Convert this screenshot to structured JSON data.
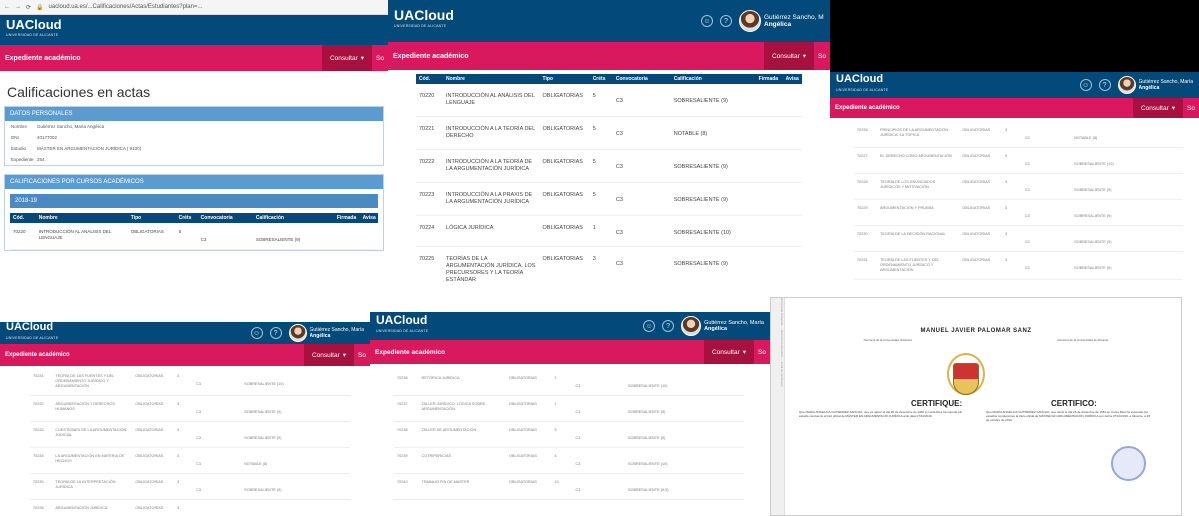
{
  "browser": {
    "url": "uacloud.ua.es/...Calificaciones/Actas/Estudiantes?plan=..."
  },
  "app": {
    "logo": "UACloud",
    "logo_sub": "UNIVERSIDAD DE ALICANTE",
    "user_line1": "Gutiérrez Sancho, María",
    "user_line2": "Angélica",
    "section": "Expediente académico",
    "consult_label": "Consultar",
    "consult_short": "So"
  },
  "page": {
    "title": "Calificaciones en actas"
  },
  "personal": {
    "header": "DATOS PERSONALES",
    "rows": [
      {
        "k": "Nombre",
        "v": "Gutiérrez Sancho, María Angélica"
      },
      {
        "k": "DNI",
        "v": "40177002"
      },
      {
        "k": "Estudio",
        "v": "MÁSTER EN ARGUMENTACIÓN JURÍDICA ( 9100)"
      },
      {
        "k": "Expediente",
        "v": "254"
      }
    ]
  },
  "grades_header": "CALIFICACIONES POR CURSOS ACADÉMICOS",
  "year": "2018-19",
  "table_headers": [
    "Cód.",
    "Nombre",
    "Tipo",
    "Créts",
    "Convocatoria",
    "Calificación",
    "Firmada",
    "Avisa"
  ],
  "rows_p1": [
    {
      "cod": "70220",
      "name": "INTRODUCCIÓN AL ANÁLISIS DEL LENGUAJE",
      "tipo": "OBLIGATORIAS",
      "creds": "5",
      "conv": "C3",
      "cal": "SOBRESALIENTE (9)"
    }
  ],
  "rows_p2": [
    {
      "cod": "70220",
      "name": "INTRODUCCIÓN AL ANÁLISIS DEL LENGUAJE",
      "tipo": "OBLIGATORIAS",
      "creds": "5",
      "conv": "C3",
      "cal": "SOBRESALIENTE (9)"
    },
    {
      "cod": "70221",
      "name": "INTRODUCCIÓN A LA TEORÍA DEL DERECHO",
      "tipo": "OBLIGATORIAS",
      "creds": "5",
      "conv": "C3",
      "cal": "NOTABLE (8)"
    },
    {
      "cod": "70222",
      "name": "INTRODUCCIÓN A LA TEORÍA DE LA ARGUMENTACIÓN JURÍDICA",
      "tipo": "OBLIGATORIAS",
      "creds": "5",
      "conv": "C3",
      "cal": "SOBRESALIENTE (9)"
    },
    {
      "cod": "70223",
      "name": "INTRODUCCIÓN A LA PRAXIS DE LA ARGUMENTACIÓN JURÍDICA",
      "tipo": "OBLIGATORIAS",
      "creds": "5",
      "conv": "C3",
      "cal": "SOBRESALIENTE (9)"
    },
    {
      "cod": "70224",
      "name": "LÓGICA JURÍDICA",
      "tipo": "OBLIGATORIAS",
      "creds": "1",
      "conv": "C3",
      "cal": "SOBRESALIENTE (10)"
    },
    {
      "cod": "70225",
      "name": "TEORÍAS DE LA ARGUMENTACIÓN JURÍDICA. LOS PRECURSORES Y LA TEORÍA ESTÁNDAR",
      "tipo": "OBLIGATORIAS",
      "creds": "3",
      "conv": "C3",
      "cal": "SOBRESALIENTE (9)"
    }
  ],
  "rows_p3": [
    {
      "cod": "70226",
      "name": "PRINCIPIOS DE LA ARGUMENTACIÓN JURÍDICA: LA TÓPICA",
      "tipo": "OBLIGATORIAS",
      "creds": "3",
      "conv": "C3",
      "cal": "NOTABLE (8)"
    },
    {
      "cod": "70227",
      "name": "EL DERECHO COMO ARGUMENTACIÓN",
      "tipo": "OBLIGATORIAS",
      "creds": "5",
      "conv": "C3",
      "cal": "SOBRESALIENTE (10)"
    },
    {
      "cod": "70228",
      "name": "TEORÍA DE LOS ENUNCIADOS JURÍDICOS Y MOTIVACIÓN",
      "tipo": "OBLIGATORIAS",
      "creds": "3",
      "conv": "C3",
      "cal": "SOBRESALIENTE (9)"
    },
    {
      "cod": "70229",
      "name": "ARGUMENTACIÓN Y PRUEBA",
      "tipo": "OBLIGATORIAS",
      "creds": "3",
      "conv": "C3",
      "cal": "SOBRESALIENTE (9)"
    },
    {
      "cod": "70230",
      "name": "TEORÍA DE LA DECISIÓN RACIONAL",
      "tipo": "OBLIGATORIAS",
      "creds": "3",
      "conv": "C3",
      "cal": "SOBRESALIENTE (9)"
    },
    {
      "cod": "70231",
      "name": "TEORÍA DE LAS FUENTES Y DEL ORDENAMIENTO JURÍDICO Y ARGUMENTACIÓN",
      "tipo": "OBLIGATORIAS",
      "creds": "3",
      "conv": "C3",
      "cal": "SOBRESALIENTE (9)"
    }
  ],
  "rows_p4": [
    {
      "cod": "70231",
      "name": "TEORÍA DE LAS FUENTES Y DEL ORDENAMIENTO JURÍDICO Y ARGUMENTACIÓN",
      "tipo": "OBLIGATORIAS",
      "creds": "3",
      "conv": "C3",
      "cal": "SOBRESALIENTE (10)"
    },
    {
      "cod": "70232",
      "name": "ARGUMENTACIÓN Y DERECHOS HUMANOS",
      "tipo": "OBLIGATORIAS",
      "creds": "3",
      "conv": "C3",
      "cal": "SOBRESALIENTE (9)"
    },
    {
      "cod": "70233",
      "name": "CUESTIONES DE LA ARGUMENTACIÓN JUDICIAL",
      "tipo": "OBLIGATORIAS",
      "creds": "3",
      "conv": "C3",
      "cal": "SOBRESALIENTE (9)"
    },
    {
      "cod": "70234",
      "name": "LA ARGUMENTACIÓN EN MATERIA DE HECHOS",
      "tipo": "OBLIGATORIAS",
      "creds": "3",
      "conv": "C3",
      "cal": "NOTABLE (8)"
    },
    {
      "cod": "70235",
      "name": "TEORÍA DE LA INTERPRETACIÓN JURÍDICA",
      "tipo": "OBLIGATORIAS",
      "creds": "3",
      "conv": "C3",
      "cal": "SOBRESALIENTE (9)"
    },
    {
      "cod": "70236",
      "name": "ARGUMENTACIÓN JURÍDICA",
      "tipo": "OBLIGATORIAS",
      "creds": "3",
      "conv": "",
      "cal": ""
    }
  ],
  "rows_p5": [
    {
      "cod": "70236",
      "name": "RETÓRICA JURÍDICA",
      "tipo": "OBLIGATORIAS",
      "creds": "1",
      "conv": "C3",
      "cal": "SOBRESALIENTE (10)"
    },
    {
      "cod": "70237",
      "name": "TALLER JURÍDICO: LÓGICA SOBRE ARGUMENTACIÓN",
      "tipo": "OBLIGATORIAS",
      "creds": "1",
      "conv": "C3",
      "cal": "SOBRESALIENTE (9)"
    },
    {
      "cod": "70238",
      "name": "TALLER DE ARGUMENTACIÓN",
      "tipo": "OBLIGATORIAS",
      "creds": "5",
      "conv": "C3",
      "cal": "SOBRESALIENTE (9)"
    },
    {
      "cod": "70239",
      "name": "COTRIPERICIAS",
      "tipo": "OBLIGATORIAS",
      "creds": "4",
      "conv": "C3",
      "cal": "SOBRESALIENTE (10)"
    },
    {
      "cod": "70240",
      "name": "TRABAJO FIN DE MÁSTER",
      "tipo": "OBLIGATORIAS",
      "creds": "10",
      "conv": "C3",
      "cal": "SOBRESALIENTE (9,5)"
    }
  ],
  "certificate": {
    "name": "MANUEL JAVIER PALOMAR SANZ",
    "rector_left": "Rector/a de la Universidad d'Alacant",
    "rector_right": "Rector/a de la Universidad de Alicante",
    "head_left": "CERTIFIQUE:",
    "head_right": "CERTIFICO:",
    "text_left": "Que MARIA ANGELICA GUTIERREZ SANCHO, que va nàixer el dia 26 de desembre de 1981 a Costa Rica ha superat els estudis conduents al títol oficial de MÀSTER EN ARGUMENTACIÓ JURÍDICA amb data 07/10/2019.",
    "text_right": "Que MARÍA ANGÉLICA GUTIÉRREZ SANCHO, que nació el día 26 de diciembre de 1981 en Costa Rica ha superado los estudios conducentes al título oficial de MÁSTER EN ARGUMENTACIÓN JURÍDICA con fecha 07/10/2019, a Alicante, a 28 de octubre de 2019.",
    "side_strip": "Universitat d'Alacant — Document electrònic — Codi de verificació"
  }
}
